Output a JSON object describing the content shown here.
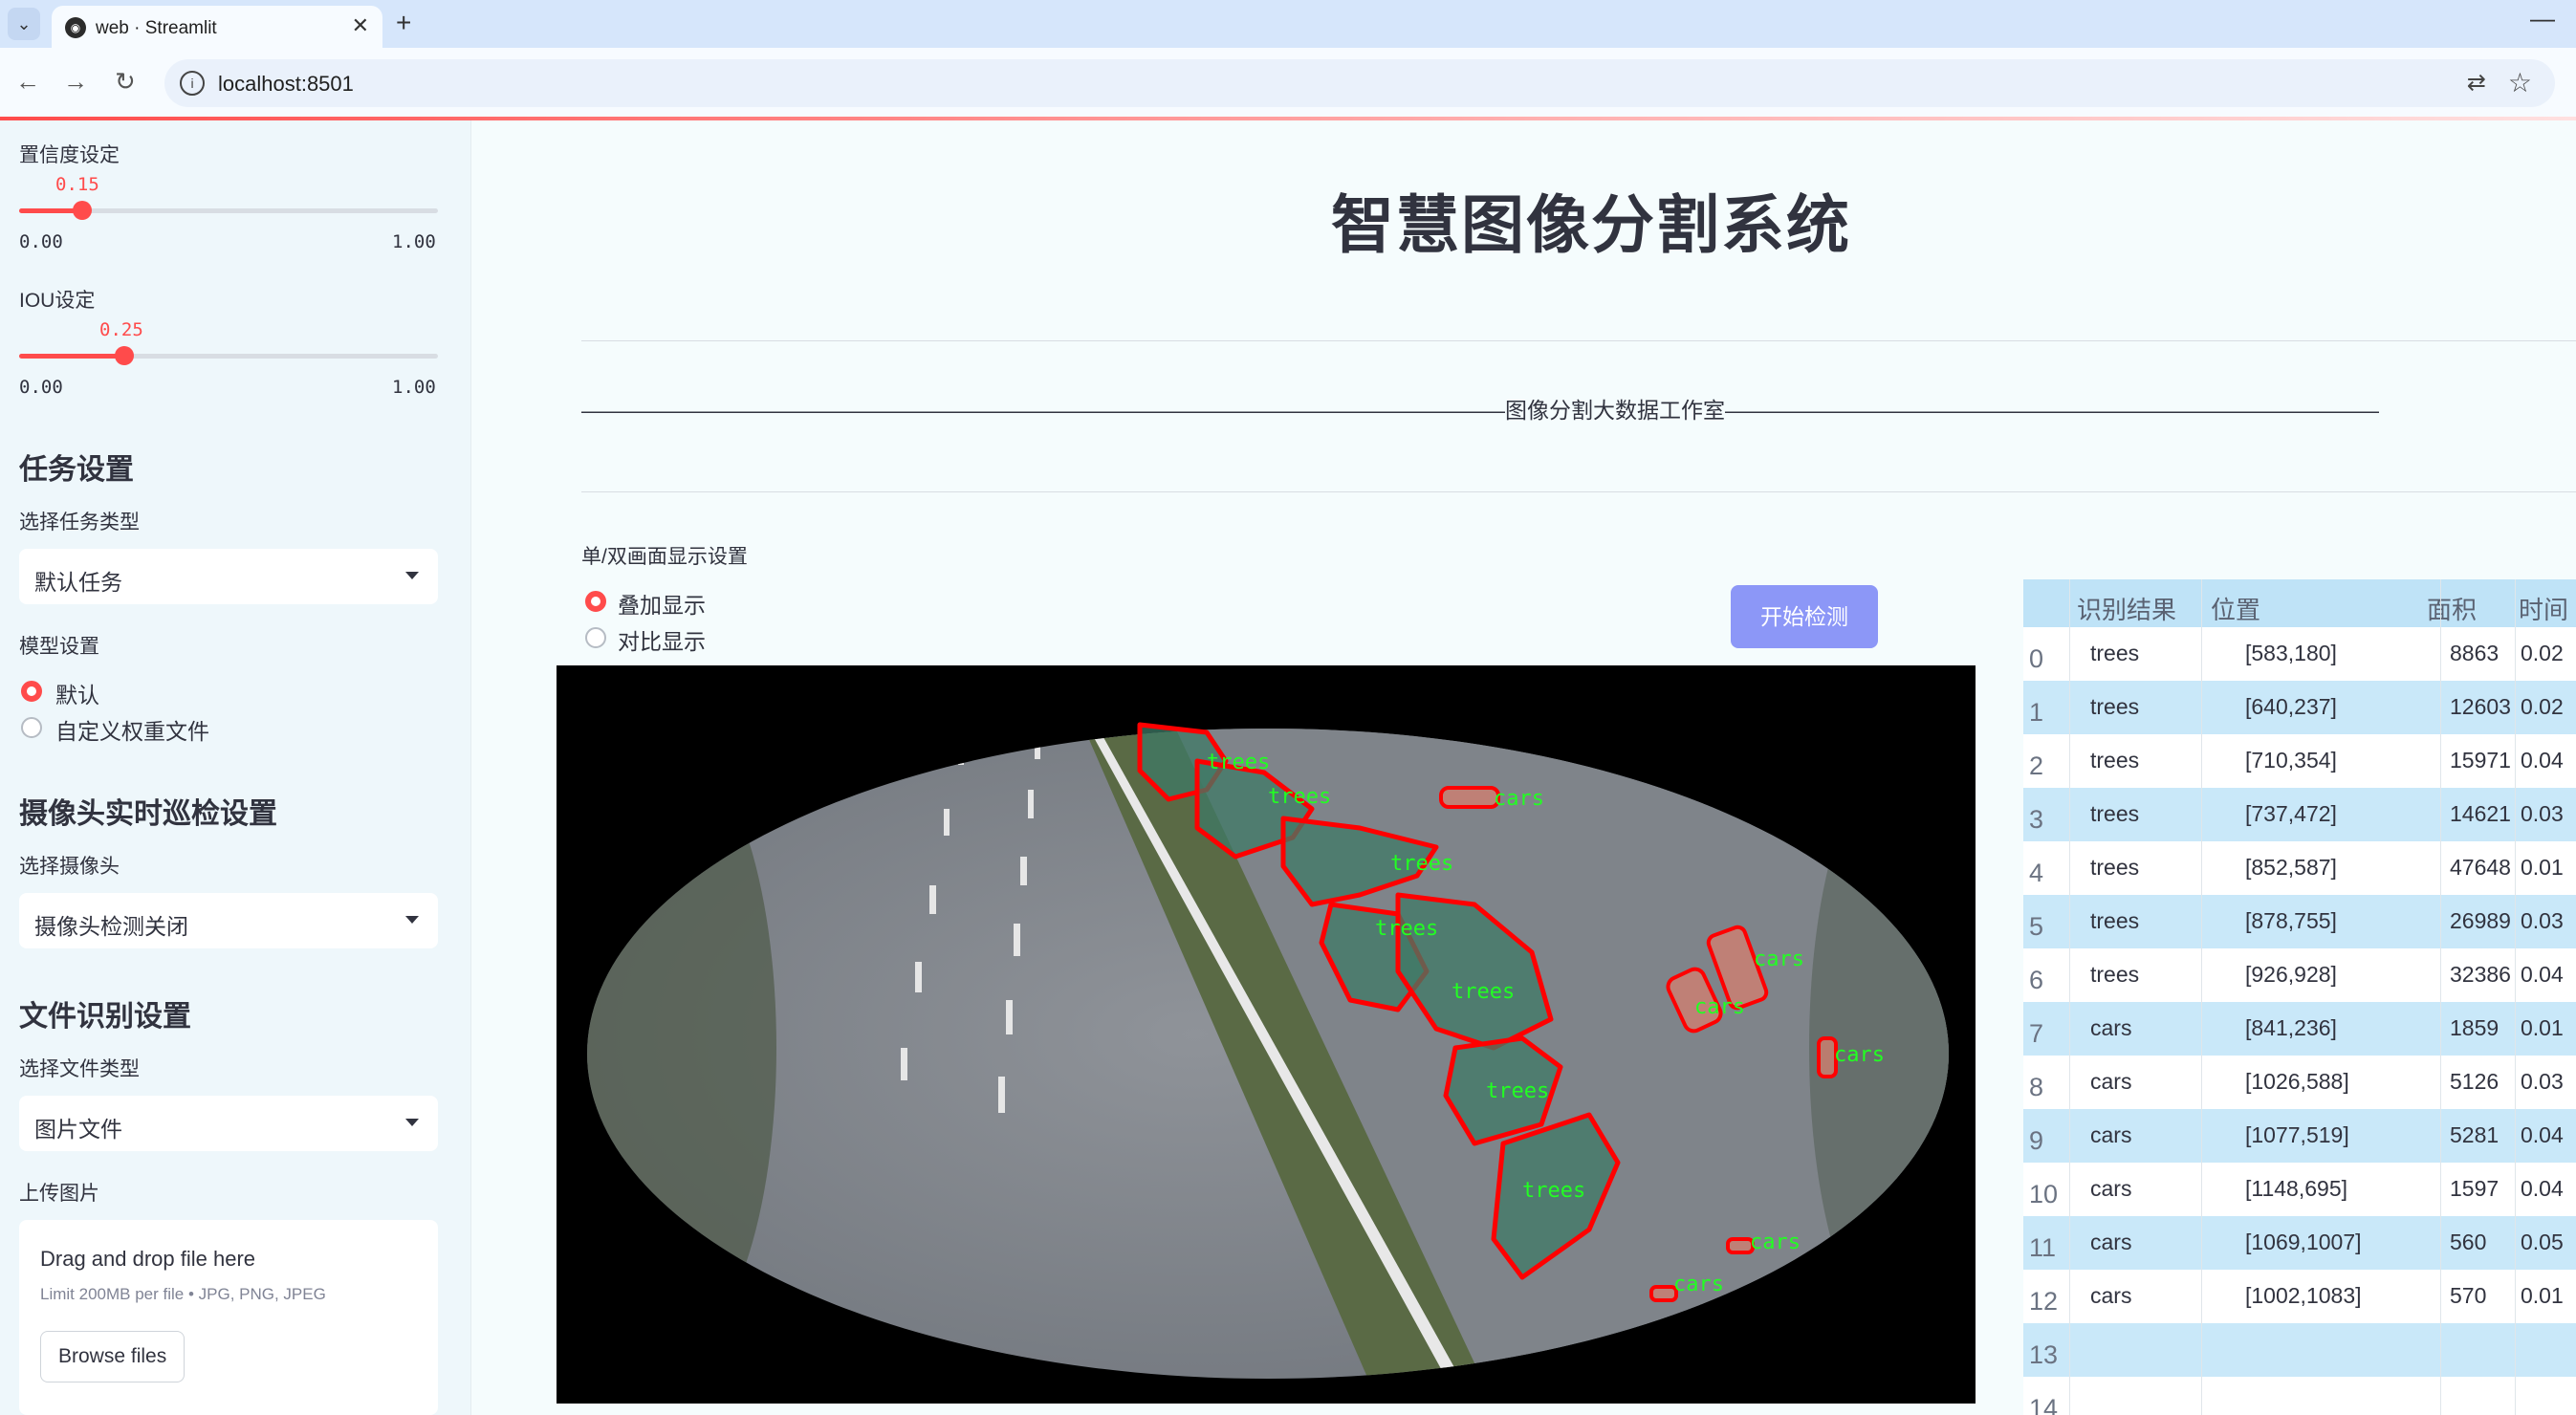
{
  "browser": {
    "tab_title": "web · Streamlit",
    "url": "localhost:8501"
  },
  "sidebar": {
    "confidence": {
      "label": "置信度设定",
      "value": "0.15",
      "min": "0.00",
      "max": "1.00",
      "fraction": 0.15
    },
    "iou": {
      "label": "IOU设定",
      "value": "0.25",
      "min": "0.00",
      "max": "1.00",
      "fraction": 0.25
    },
    "task_heading": "任务设置",
    "task_type_label": "选择任务类型",
    "task_type_value": "默认任务",
    "model_label": "模型设置",
    "model_options": [
      "默认",
      "自定义权重文件"
    ],
    "camera_heading": "摄像头实时巡检设置",
    "camera_label": "选择摄像头",
    "camera_value": "摄像头检测关闭",
    "file_heading": "文件识别设置",
    "file_type_label": "选择文件类型",
    "file_type_value": "图片文件",
    "upload_label": "上传图片",
    "upload_title": "Drag and drop file here",
    "upload_limit": "Limit 200MB per file • JPG, PNG, JPEG",
    "browse_label": "Browse files"
  },
  "main": {
    "title": "智慧图像分割系统",
    "studio_line": "——————————————————————————————————————————图像分割大数据工作室———————————————————————————————————————————",
    "display_mode_label": "单/双画面显示设置",
    "display_options": [
      "叠加显示",
      "对比显示"
    ],
    "detect_button": "开始检测"
  },
  "image_labels": {
    "trees": "trees",
    "cars": "cars"
  },
  "table": {
    "headers": [
      "识别结果",
      "位置",
      "面积",
      "时间"
    ],
    "rows": [
      {
        "idx": "0",
        "cls": "trees",
        "pos": "[583,180]",
        "area": "8863",
        "time": "0.02"
      },
      {
        "idx": "1",
        "cls": "trees",
        "pos": "[640,237]",
        "area": "12603",
        "time": "0.02"
      },
      {
        "idx": "2",
        "cls": "trees",
        "pos": "[710,354]",
        "area": "15971",
        "time": "0.04"
      },
      {
        "idx": "3",
        "cls": "trees",
        "pos": "[737,472]",
        "area": "14621",
        "time": "0.03"
      },
      {
        "idx": "4",
        "cls": "trees",
        "pos": "[852,587]",
        "area": "47648",
        "time": "0.01"
      },
      {
        "idx": "5",
        "cls": "trees",
        "pos": "[878,755]",
        "area": "26989",
        "time": "0.03"
      },
      {
        "idx": "6",
        "cls": "trees",
        "pos": "[926,928]",
        "area": "32386",
        "time": "0.04"
      },
      {
        "idx": "7",
        "cls": "cars",
        "pos": "[841,236]",
        "area": "1859",
        "time": "0.01"
      },
      {
        "idx": "8",
        "cls": "cars",
        "pos": "[1026,588]",
        "area": "5126",
        "time": "0.03"
      },
      {
        "idx": "9",
        "cls": "cars",
        "pos": "[1077,519]",
        "area": "5281",
        "time": "0.04"
      },
      {
        "idx": "10",
        "cls": "cars",
        "pos": "[1148,695]",
        "area": "1597",
        "time": "0.04"
      },
      {
        "idx": "11",
        "cls": "cars",
        "pos": "[1069,1007]",
        "area": "560",
        "time": "0.05"
      },
      {
        "idx": "12",
        "cls": "cars",
        "pos": "[1002,1083]",
        "area": "570",
        "time": "0.01"
      },
      {
        "idx": "13",
        "cls": "",
        "pos": "",
        "area": "",
        "time": ""
      },
      {
        "idx": "14",
        "cls": "",
        "pos": "",
        "area": "",
        "time": ""
      }
    ]
  },
  "colors": {
    "accent": "#ff4b4b",
    "button": "#8c97f7",
    "row_alt": "#c9e8f9",
    "mask_outline": "#ff0000",
    "mask_label": "#22ff22"
  }
}
